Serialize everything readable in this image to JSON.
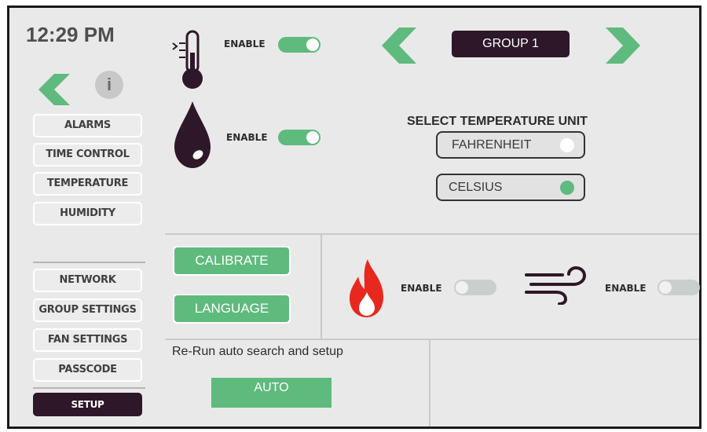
{
  "clock": {
    "time": "12:29 PM"
  },
  "icons": {
    "back": "chevron-left-icon",
    "info": "info-icon",
    "info_glyph": "i",
    "thermometer": "thermometer-icon",
    "drop": "water-drop-icon",
    "prev": "chevron-left-icon",
    "next": "chevron-right-icon",
    "flame": "flame-icon",
    "wind": "wind-icon"
  },
  "sidebar": {
    "items": [
      {
        "label": "ALARMS"
      },
      {
        "label": "TIME CONTROL"
      },
      {
        "label": "TEMPERATURE"
      },
      {
        "label": "HUMIDITY"
      },
      {
        "label": "NETWORK"
      },
      {
        "label": "GROUP SETTINGS"
      },
      {
        "label": "FAN SETTINGS"
      },
      {
        "label": "PASSCODE"
      },
      {
        "label": "SETUP"
      }
    ]
  },
  "sensors": {
    "temperature": {
      "label": "ENABLE",
      "enabled": true
    },
    "humidity": {
      "label": "ENABLE",
      "enabled": true
    },
    "heater": {
      "label": "ENABLE",
      "enabled": false
    },
    "fan": {
      "label": "ENABLE",
      "enabled": false
    }
  },
  "group": {
    "label": "GROUP 1"
  },
  "units": {
    "title": "SELECT TEMPERATURE UNIT",
    "fahrenheit": {
      "label": "FAHRENHEIT",
      "selected": false
    },
    "celsius": {
      "label": "CELSIUS",
      "selected": true
    }
  },
  "actions": {
    "calibrate": "CALIBRATE",
    "language": "LANGUAGE",
    "rerun_text": "Re-Run auto search and setup",
    "auto": "AUTO"
  },
  "colors": {
    "accent_green": "#5fba7d",
    "dark_purple": "#2d1728",
    "flame_red": "#e8281e",
    "background": "#e9e9e9"
  }
}
